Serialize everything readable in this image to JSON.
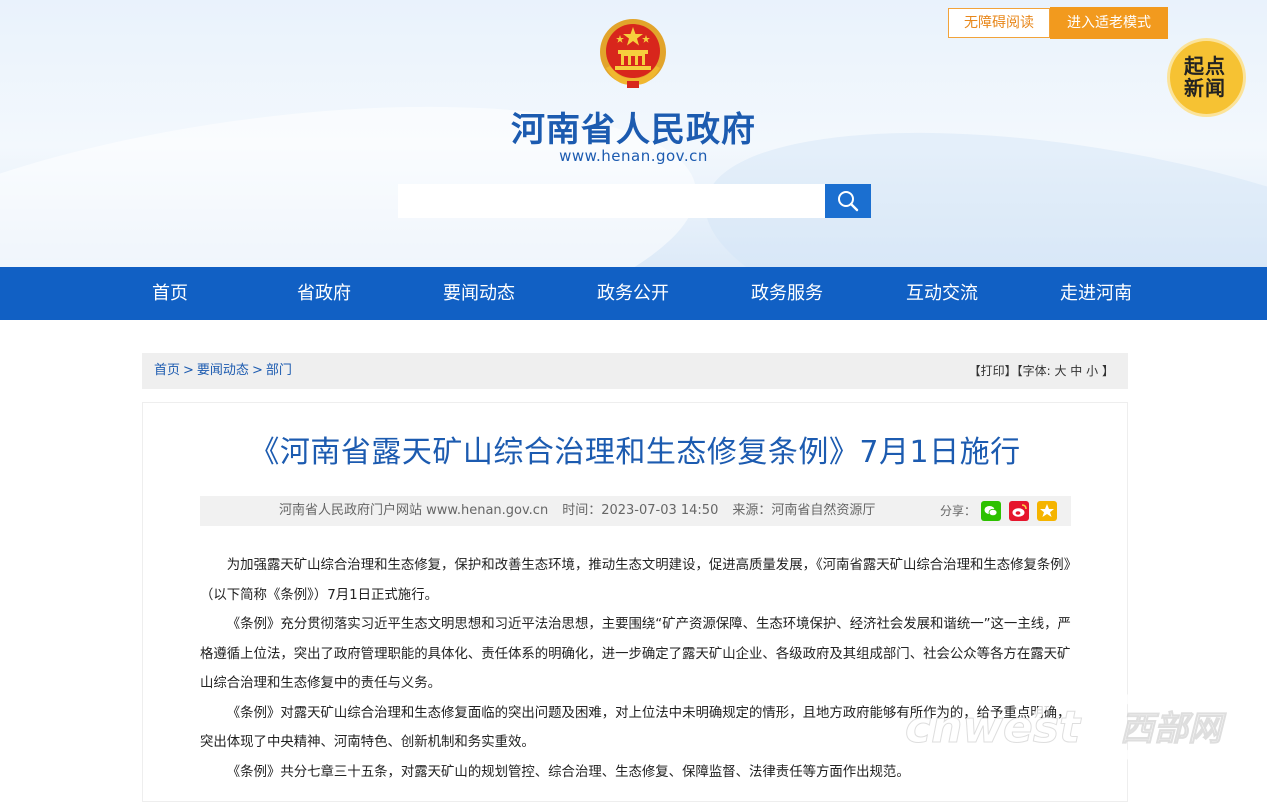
{
  "header": {
    "accessibility_label": "无障碍阅读",
    "elder_mode_label": "进入适老模式",
    "site_title": "河南省人民政府",
    "site_url": "www.henan.gov.cn",
    "search_placeholder": "",
    "qidian_chars": [
      "起",
      "点",
      "新",
      "闻"
    ]
  },
  "nav": {
    "items": [
      "首页",
      "省政府",
      "要闻动态",
      "政务公开",
      "政务服务",
      "互动交流",
      "走进河南"
    ]
  },
  "breadcrumb": {
    "items": [
      "首页",
      "要闻动态",
      "部门"
    ],
    "separator": ">"
  },
  "tools": {
    "print": "【打印】",
    "font_label": "【字体:",
    "font_large": "大",
    "font_medium": "中",
    "font_small": "小",
    "font_close": "】"
  },
  "article": {
    "title": "《河南省露天矿山综合治理和生态修复条例》7月1日施行",
    "source_site": "河南省人民政府门户网站 www.henan.gov.cn",
    "time": "时间：2023-07-03 14:50",
    "origin": "来源：河南省自然资源厅",
    "share_label": "分享：",
    "paragraphs": [
      "为加强露天矿山综合治理和生态修复，保护和改善生态环境，推动生态文明建设，促进高质量发展，《河南省露天矿山综合治理和生态修复条例》（以下简称《条例》）7月1日正式施行。",
      "《条例》充分贯彻落实习近平生态文明思想和习近平法治思想，主要围绕“矿产资源保障、生态环境保护、经济社会发展和谐统一”这一主线，严格遵循上位法，突出了政府管理职能的具体化、责任体系的明确化，进一步确定了露天矿山企业、各级政府及其组成部门、社会公众等各方在露天矿山综合治理和生态修复中的责任与义务。",
      "《条例》对露天矿山综合治理和生态修复面临的突出问题及困难，对上位法中未明确规定的情形，且地方政府能够有所作为的，给予重点明确，突出体现了中央精神、河南特色、创新机制和务实重效。",
      "《条例》共分七章三十五条，对露天矿山的规划管控、综合治理、生态修复、保障监督、法律责任等方面作出规范。"
    ]
  },
  "watermark": {
    "latin": "cnwest",
    "cjk": "西部网"
  },
  "colors": {
    "nav_bg": "#1160c4",
    "title_blue": "#1c5bb0",
    "accent_orange": "#f29a1e",
    "wechat_green": "#2dc100",
    "weibo_red": "#e6162d",
    "star_yellow": "#f5b400"
  }
}
